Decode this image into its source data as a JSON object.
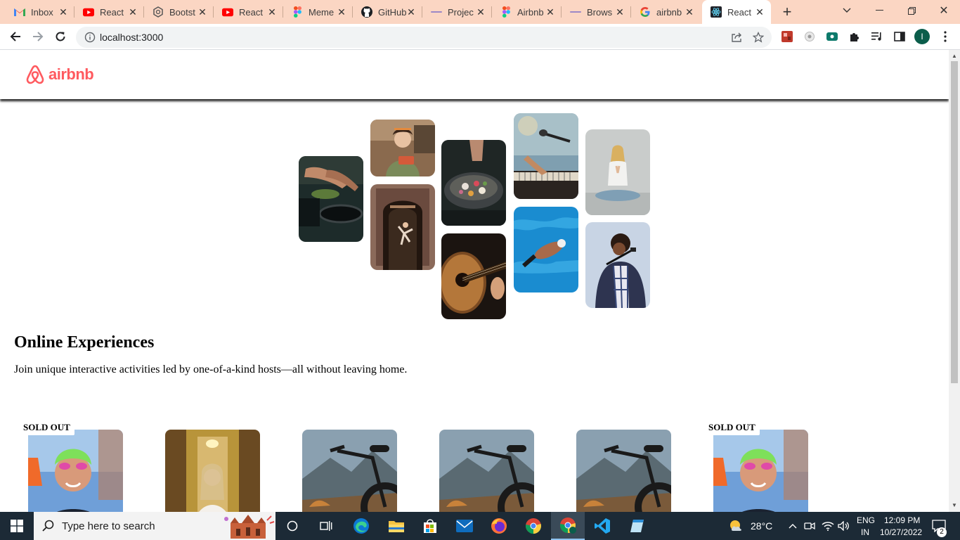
{
  "browser": {
    "tabs": [
      {
        "title": "Inbox",
        "icon": "gmail-icon"
      },
      {
        "title": "React",
        "icon": "youtube-icon"
      },
      {
        "title": "Bootst",
        "icon": "bootstrap-icon"
      },
      {
        "title": "React",
        "icon": "youtube-icon"
      },
      {
        "title": "Meme",
        "icon": "figma-icon"
      },
      {
        "title": "GitHub",
        "icon": "github-icon"
      },
      {
        "title": "Projec",
        "icon": "page-icon"
      },
      {
        "title": "Airbnb",
        "icon": "figma-icon"
      },
      {
        "title": "Brows",
        "icon": "page-icon"
      },
      {
        "title": "airbnb",
        "icon": "google-icon"
      },
      {
        "title": "React",
        "icon": "react-icon",
        "active": true
      }
    ],
    "url": "localhost:3000",
    "profile_initial": "I",
    "tabstrip_color": "#fbd6c3"
  },
  "page": {
    "logo_text": "airbnb",
    "brand_color": "#ff5a5f",
    "hero": {
      "title": "Online Experiences",
      "text": "Join unique interactive activities led by one-of-a-kind hosts—all without leaving home."
    },
    "cards": [
      {
        "badge": "SOLD OUT",
        "image": "swimmer-photo"
      },
      {
        "badge": "",
        "image": "wedding-photo"
      },
      {
        "badge": "",
        "image": "mountain-bike-photo"
      },
      {
        "badge": "",
        "image": "mountain-bike-photo"
      },
      {
        "badge": "",
        "image": "mountain-bike-photo"
      },
      {
        "badge": "SOLD OUT",
        "image": "swimmer-photo"
      }
    ]
  },
  "taskbar": {
    "search_placeholder": "Type here to search",
    "weather": "28°C",
    "lang_line1": "ENG",
    "lang_line2": "IN",
    "time": "12:09 PM",
    "date": "10/27/2022",
    "notifications": "2"
  }
}
